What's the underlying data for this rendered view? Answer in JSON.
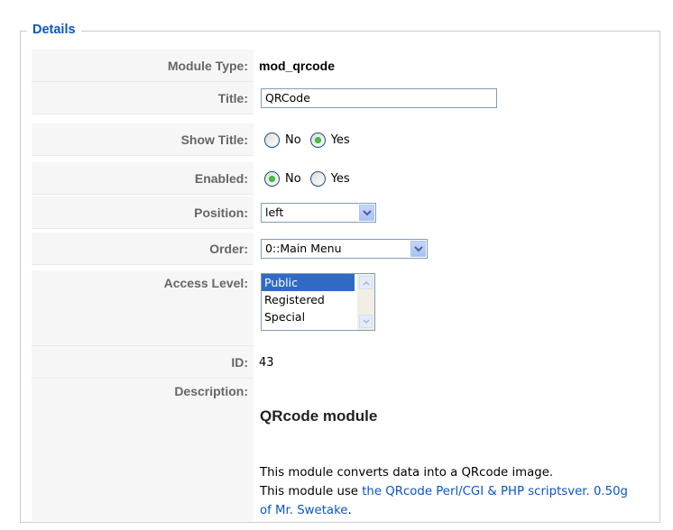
{
  "legend": "Details",
  "module_type": {
    "label": "Module Type:",
    "value": "mod_qrcode"
  },
  "title": {
    "label": "Title:",
    "value": "QRCode"
  },
  "show_title": {
    "label": "Show Title:",
    "options": [
      "No",
      "Yes"
    ],
    "selected": "Yes"
  },
  "enabled": {
    "label": "Enabled:",
    "options": [
      "No",
      "Yes"
    ],
    "selected": "No"
  },
  "position": {
    "label": "Position:",
    "value": "left"
  },
  "order": {
    "label": "Order:",
    "value": "0::Main Menu"
  },
  "access_level": {
    "label": "Access Level:",
    "options": [
      "Public",
      "Registered",
      "Special"
    ],
    "selected": "Public"
  },
  "id": {
    "label": "ID:",
    "value": "43"
  },
  "description": {
    "label": "Description:",
    "heading": "QRcode module",
    "line1": "This module converts data into a QRcode image.",
    "line2_prefix": "This module use ",
    "link_text": "the QRcode Perl/CGI & PHP scriptsver. 0.50g of Mr. Swetake",
    "line2_suffix": "."
  },
  "colors": {
    "legend": "#0b55c4",
    "link": "#0b55c4",
    "label": "#666666",
    "key_bg": "#f6f6f6"
  }
}
